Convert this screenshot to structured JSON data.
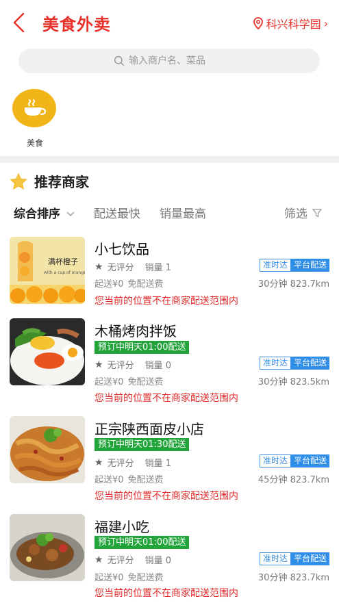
{
  "header": {
    "title": "美食外卖",
    "location": "科兴科学园"
  },
  "search": {
    "placeholder": "输入商户名、菜品"
  },
  "category": {
    "label": "美食"
  },
  "section": {
    "title": "推荐商家"
  },
  "sort": {
    "comprehensive": "综合排序",
    "fastest": "配送最快",
    "sales": "销量最高",
    "filter": "筛选"
  },
  "shops": [
    {
      "name": "小七饮品",
      "preorder": "",
      "rating": "无评分",
      "sales": "销量 1",
      "tag_ontime": "准时达",
      "tag_platform": "平台配送",
      "min_order": "起送¥0",
      "delivery_fee": "免配送费",
      "distance": "30分钟 823.7km",
      "warning": "您当前的位置不在商家配送范围内",
      "image_text": "满杯橙子"
    },
    {
      "name": "木桶烤肉拌饭",
      "preorder": "预订中明天01:00配送",
      "rating": "无评分",
      "sales": "销量 0",
      "tag_ontime": "准时达",
      "tag_platform": "平台配送",
      "min_order": "起送¥0",
      "delivery_fee": "免配送费",
      "distance": "30分钟 823.5km",
      "warning": "您当前的位置不在商家配送范围内"
    },
    {
      "name": "正宗陕西面皮小店",
      "preorder": "预订中明天01:30配送",
      "rating": "无评分",
      "sales": "销量 1",
      "tag_ontime": "准时达",
      "tag_platform": "平台配送",
      "min_order": "起送¥0",
      "delivery_fee": "免配送费",
      "distance": "45分钟 823.7km",
      "warning": "您当前的位置不在商家配送范围内"
    },
    {
      "name": "福建小吃",
      "preorder": "预订中明天01:00配送",
      "rating": "无评分",
      "sales": "销量 0",
      "tag_ontime": "准时达",
      "tag_platform": "平台配送",
      "min_order": "起送¥0",
      "delivery_fee": "免配送费",
      "distance": "30分钟 823.7km",
      "warning": "您当前的位置不在商家配送范围内"
    }
  ]
}
